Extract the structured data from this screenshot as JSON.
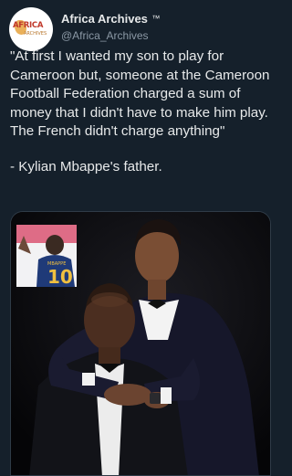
{
  "account": {
    "display_name": "Africa Archives",
    "badge": "™",
    "handle": "@Africa_Archives",
    "avatar": {
      "logo_main": "AFRICA",
      "logo_sub": "ARCHIVES"
    }
  },
  "tweet": {
    "paragraphs": [
      "\"At first I wanted my son to play for Cameroon but, someone at the Cameroon Football Federation charged a sum of money that I didn't have to make him play. The French didn't charge anything\"",
      "- Kylian Mbappe's father."
    ]
  },
  "media": {
    "inset": {
      "jersey_name": "MBAPPE",
      "jersey_number": "10"
    }
  },
  "colors": {
    "background": "#15202b",
    "text_primary": "#e7e9ea",
    "text_secondary": "#8b98a5"
  }
}
